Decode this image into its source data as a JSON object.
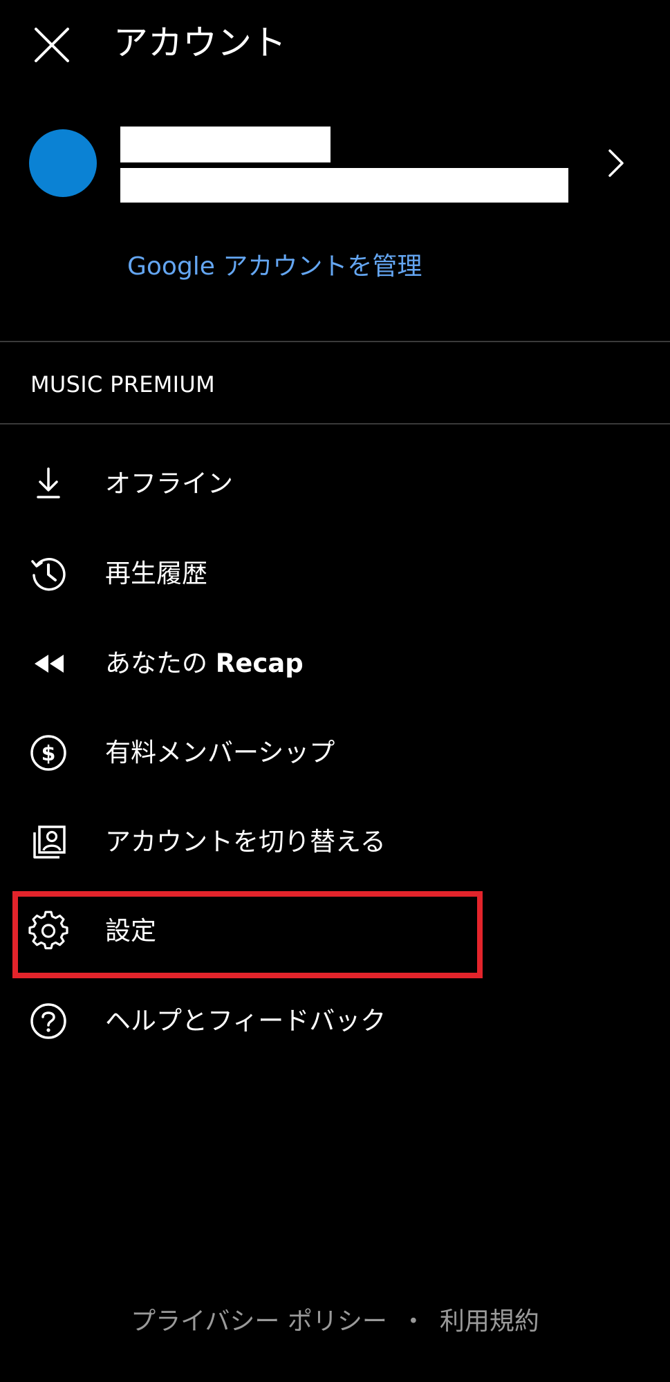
{
  "header": {
    "title": "アカウント",
    "close_icon": "close-icon"
  },
  "account": {
    "avatar_color": "#0b82d4",
    "name_redacted": "",
    "email_redacted": "",
    "chevron_icon": "chevron-right-icon",
    "manage_link": "Google アカウントを管理"
  },
  "section": {
    "label": "MUSIC PREMIUM"
  },
  "menu": {
    "items": [
      {
        "label": "オフライン",
        "icon": "download-icon"
      },
      {
        "label": "再生履歴",
        "icon": "history-icon"
      },
      {
        "label_prefix": "あなたの ",
        "label_strong": "Recap",
        "icon": "rewind-icon"
      },
      {
        "label": "有料メンバーシップ",
        "icon": "dollar-icon"
      },
      {
        "label": "アカウントを切り替える",
        "icon": "switch-account-icon"
      },
      {
        "label": "設定",
        "icon": "gear-icon"
      },
      {
        "label": "ヘルプとフィードバック",
        "icon": "help-icon"
      }
    ]
  },
  "highlight": {
    "color": "#e3242b",
    "target": "設定"
  },
  "footer": {
    "privacy": "プライバシー ポリシー",
    "separator": "・",
    "terms": "利用規約"
  },
  "colors": {
    "background": "#000000",
    "link": "#64a6f2",
    "divider": "#3a3a3a",
    "footer_text": "#9a9a9a"
  }
}
